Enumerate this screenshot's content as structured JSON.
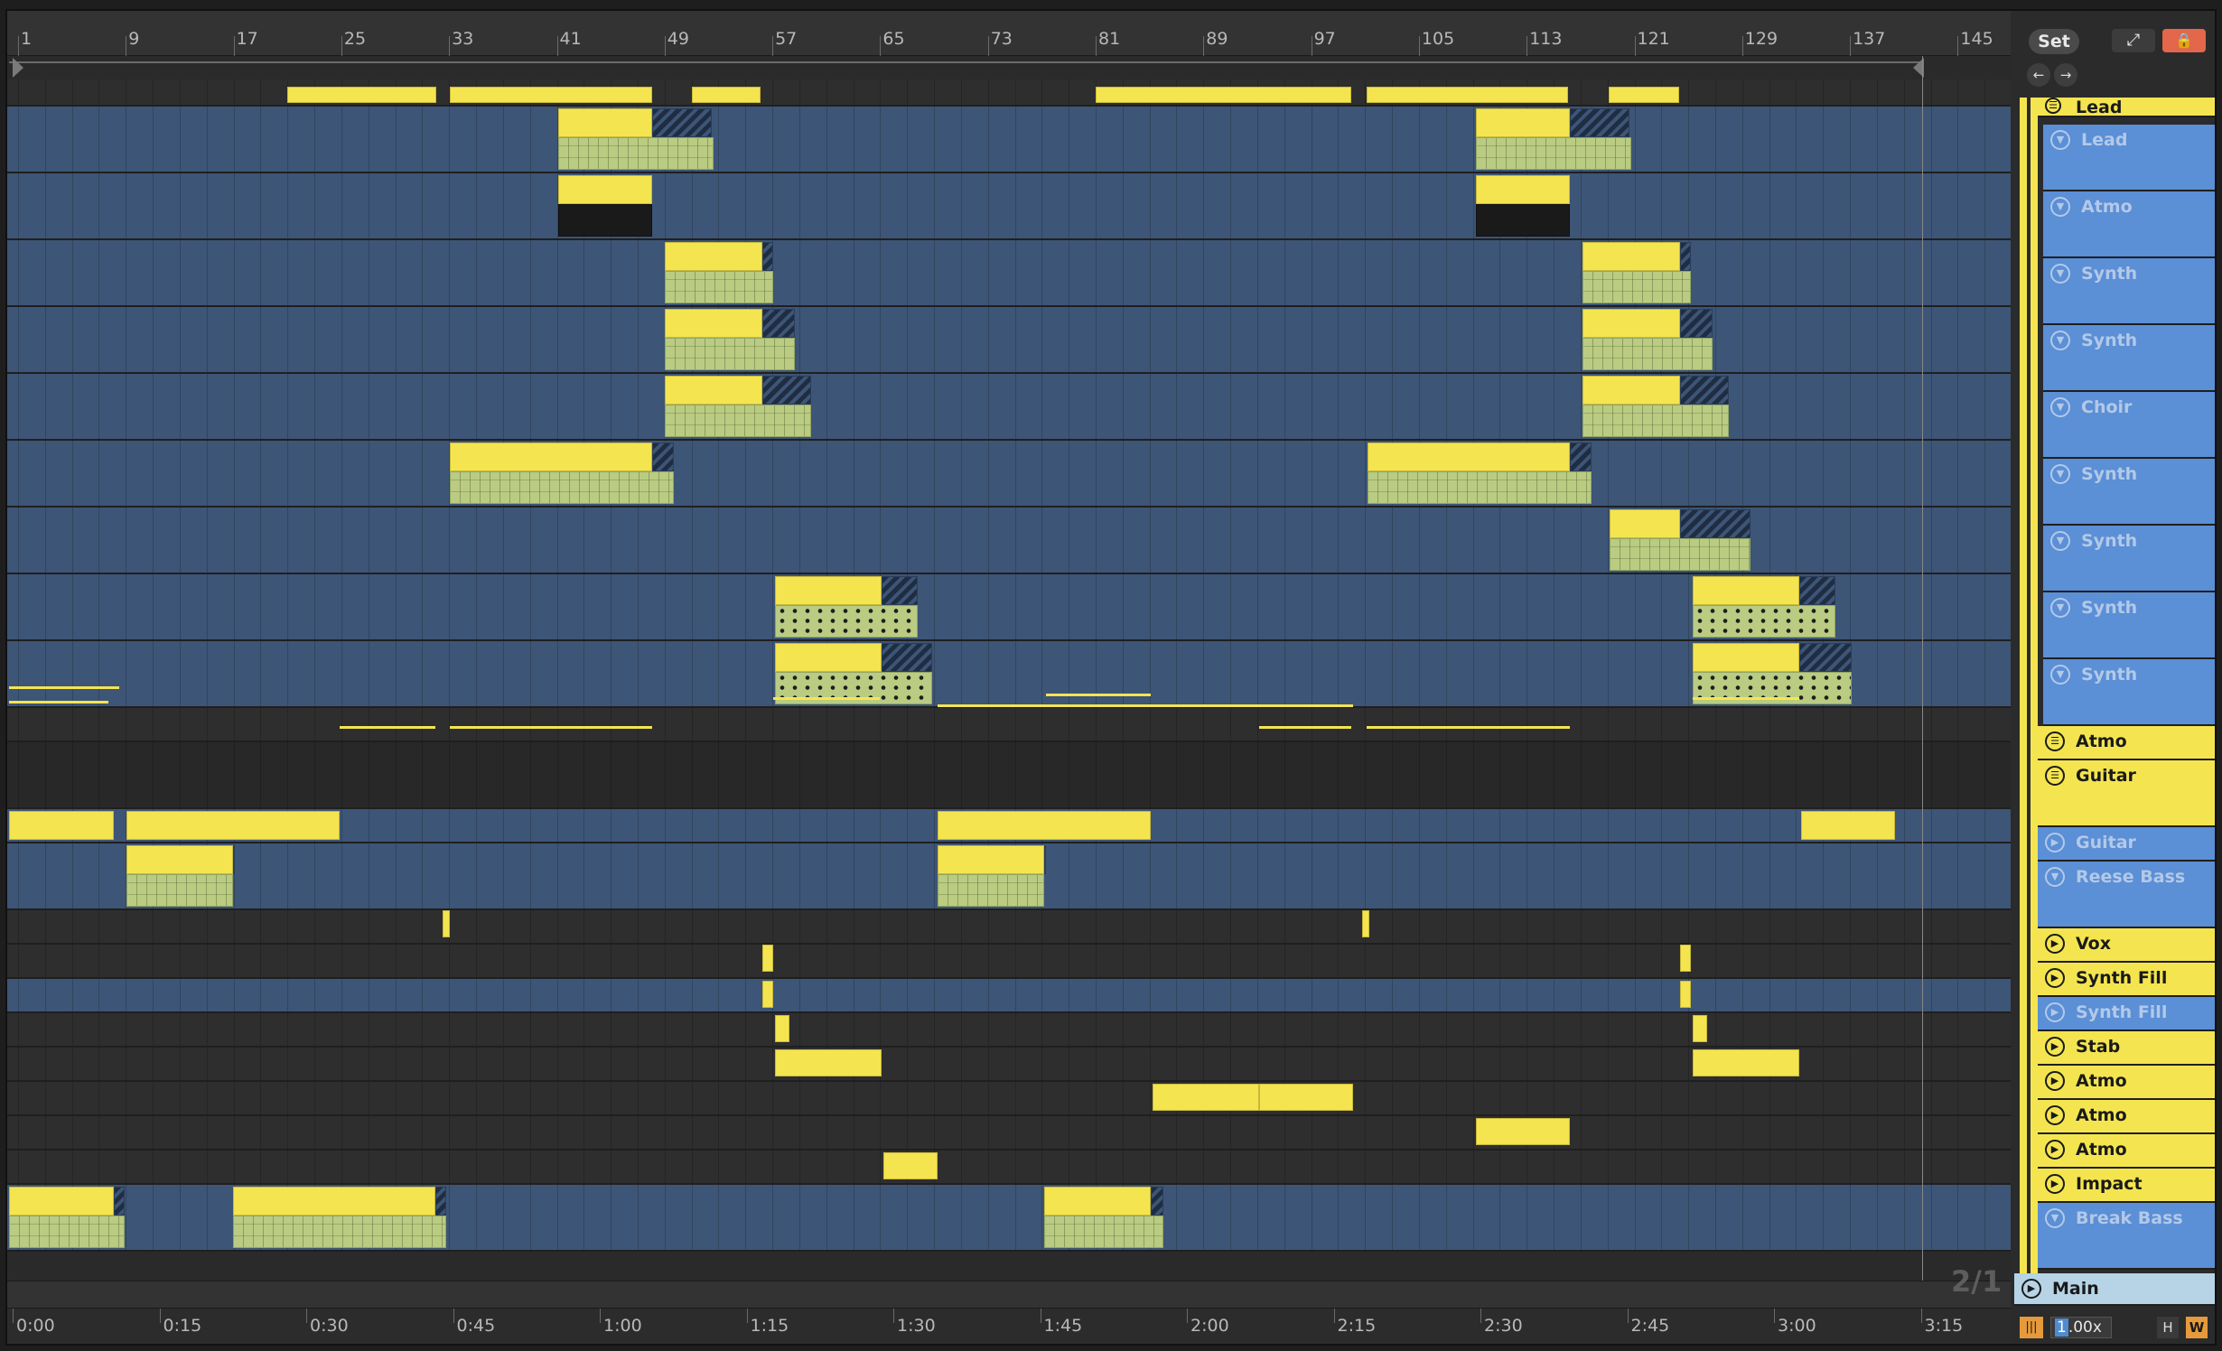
{
  "ruler": {
    "bars": [
      "1",
      "9",
      "17",
      "25",
      "33",
      "41",
      "49",
      "57",
      "65",
      "73",
      "81",
      "89",
      "97",
      "105",
      "113",
      "121",
      "129",
      "137",
      "145"
    ]
  },
  "timeline": {
    "times": [
      "0:00",
      "0:15",
      "0:30",
      "0:45",
      "1:00",
      "1:15",
      "1:30",
      "1:45",
      "2:00",
      "2:15",
      "2:30",
      "2:45",
      "3:00",
      "3:15"
    ]
  },
  "time_signature": "2/1",
  "panel": {
    "set_label": "Set",
    "tracks": [
      {
        "name": "Lead",
        "style": "yellow",
        "icon": "group-icon"
      },
      {
        "name": "Lead",
        "style": "blue",
        "icon": "chevron-icon"
      },
      {
        "name": "Atmo",
        "style": "blue",
        "icon": "chevron-icon"
      },
      {
        "name": "Synth",
        "style": "blue",
        "icon": "chevron-icon"
      },
      {
        "name": "Synth",
        "style": "blue",
        "icon": "chevron-icon"
      },
      {
        "name": "Choir",
        "style": "blue",
        "icon": "chevron-icon"
      },
      {
        "name": "Synth",
        "style": "blue",
        "icon": "chevron-icon"
      },
      {
        "name": "Synth",
        "style": "blue",
        "icon": "chevron-icon"
      },
      {
        "name": "Synth",
        "style": "blue",
        "icon": "chevron-icon"
      },
      {
        "name": "Synth",
        "style": "blue",
        "icon": "chevron-icon"
      },
      {
        "name": "Atmo",
        "style": "yellow",
        "icon": "group-icon"
      },
      {
        "name": "Guitar",
        "style": "yellow",
        "icon": "group-icon"
      },
      {
        "name": "Guitar",
        "style": "blue",
        "icon": "play-icon"
      },
      {
        "name": "Reese Bass",
        "style": "blue",
        "icon": "chevron-icon"
      },
      {
        "name": "Vox",
        "style": "yellow",
        "icon": "play-icon"
      },
      {
        "name": "Synth Fill",
        "style": "yellow",
        "icon": "play-icon"
      },
      {
        "name": "Synth Fill",
        "style": "blue",
        "icon": "play-icon"
      },
      {
        "name": "Stab",
        "style": "yellow",
        "icon": "play-icon"
      },
      {
        "name": "Atmo",
        "style": "yellow",
        "icon": "play-icon"
      },
      {
        "name": "Atmo",
        "style": "yellow",
        "icon": "play-icon"
      },
      {
        "name": "Atmo",
        "style": "yellow",
        "icon": "play-icon"
      },
      {
        "name": "Impact",
        "style": "yellow",
        "icon": "play-icon"
      },
      {
        "name": "Break Bass",
        "style": "blue",
        "icon": "chevron-icon"
      }
    ],
    "main_label": "Main",
    "speed_value": "1",
    "speed_suffix": ".00x",
    "h_label": "H",
    "w_label": "W"
  },
  "colors": {
    "clip_yellow": "#f4e550",
    "clip_body": "#b9cc82",
    "lane_blue": "#3d5576",
    "header_blue": "#5b8fd6",
    "main_blue": "#b6d4e6",
    "lock_red": "#e2674b",
    "orange": "#e59a3c"
  }
}
